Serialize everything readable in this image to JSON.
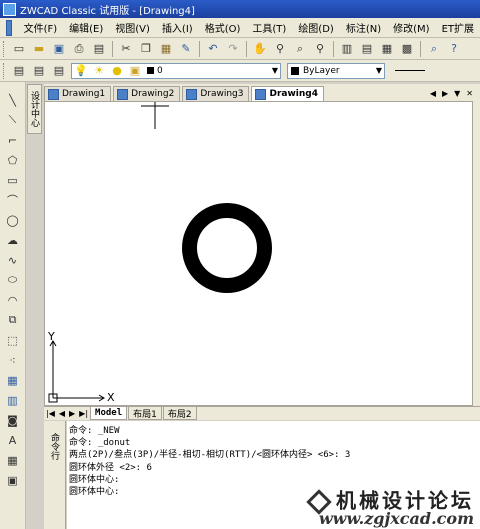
{
  "window": {
    "title": "ZWCAD Classic 试用版 - [Drawing4]"
  },
  "menu": [
    "文件(F)",
    "编辑(E)",
    "视图(V)",
    "插入(I)",
    "格式(O)",
    "工具(T)",
    "绘图(D)",
    "标注(N)",
    "修改(M)",
    "ET扩展"
  ],
  "layer": {
    "current": "0"
  },
  "color": {
    "current": "ByLayer"
  },
  "left_panel": {
    "label": "设计中心"
  },
  "drawing_tabs": [
    {
      "label": "Drawing1",
      "active": false
    },
    {
      "label": "Drawing2",
      "active": false
    },
    {
      "label": "Drawing3",
      "active": false
    },
    {
      "label": "Drawing4",
      "active": true
    }
  ],
  "canvas": {
    "ucs": {
      "x_label": "X",
      "y_label": "Y"
    },
    "donut": {
      "color": "#000000"
    }
  },
  "layout_tabs": [
    {
      "label": "Model",
      "active": true
    },
    {
      "label": "布局1",
      "active": false
    },
    {
      "label": "布局2",
      "active": false
    }
  ],
  "command_panel": {
    "label": "命令行"
  },
  "command_lines": [
    "命令: _NEW",
    "命令: _donut",
    "两点(2P)/叁点(3P)/半径-相切-相切(RTT)/<圆环体内径> <6>: 3",
    "圆环体外径 <2>: 6",
    "圆环体中心:",
    "圆环体中心:"
  ],
  "watermark": {
    "text": "机械设计论坛",
    "url": "www.zgjxcad.com"
  },
  "icons": {
    "toolbar1": [
      "new-icon",
      "open-icon",
      "save-icon",
      "print-icon",
      "preview-icon",
      "cut-icon",
      "copy-icon",
      "paste-icon",
      "match-icon",
      "undo-icon",
      "redo-icon",
      "pan-icon",
      "zoom-realtime-icon",
      "zoom-window-icon",
      "zoom-prev-icon",
      "properties-icon",
      "design-center-icon",
      "tool-palette-icon",
      "calc-icon",
      "help-icon"
    ],
    "left": [
      "line-icon",
      "xline-icon",
      "polyline-icon",
      "polygon-icon",
      "rectangle-icon",
      "arc-icon",
      "circle-icon",
      "revcloud-icon",
      "spline-icon",
      "ellipse-icon",
      "ellipse-arc-icon",
      "insert-block-icon",
      "make-block-icon",
      "point-icon",
      "hatch-icon",
      "gradient-icon",
      "region-icon",
      "mtext-icon",
      "table-icon",
      "image-icon"
    ]
  }
}
